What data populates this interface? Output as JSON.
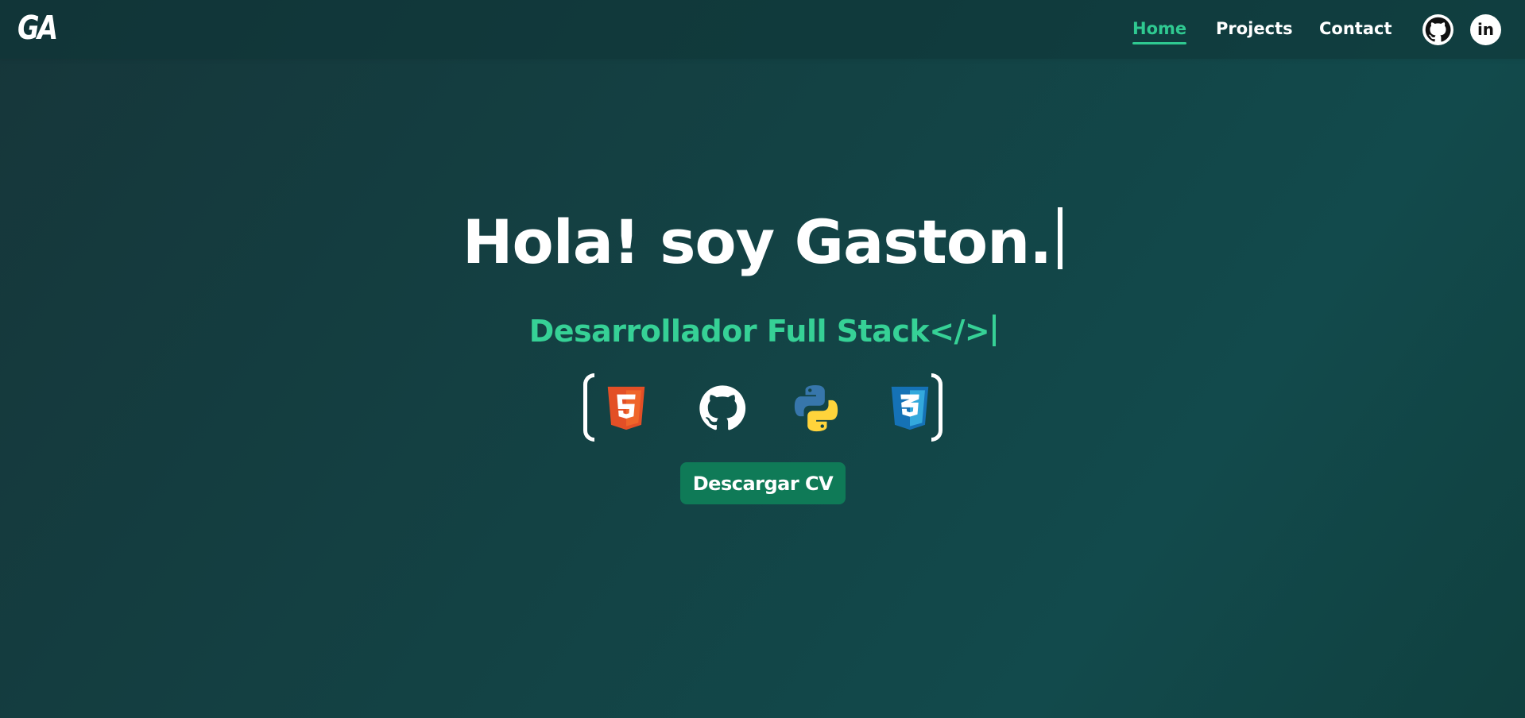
{
  "brand": {
    "logo_text": "GA"
  },
  "nav": {
    "items": [
      {
        "label": "Home",
        "active": true
      },
      {
        "label": "Projects",
        "active": false
      },
      {
        "label": "Contact",
        "active": false
      }
    ],
    "social": [
      {
        "icon": "github-icon"
      },
      {
        "icon": "linkedin-icon",
        "text": "in"
      }
    ]
  },
  "hero": {
    "title": "Hola! soy Gaston.",
    "subtitle": "Desarrollador Full Stack</>"
  },
  "skills": [
    {
      "icon": "html5-icon",
      "text": "5"
    },
    {
      "icon": "github-icon"
    },
    {
      "icon": "python-icon"
    },
    {
      "icon": "css3-icon",
      "text": "3"
    }
  ],
  "cta": {
    "label": "Descargar CV"
  },
  "colors": {
    "accent": "#2fc991",
    "background": "#134244",
    "button": "#0f7a57",
    "html5": "#e34f26",
    "css3": "#1572b6",
    "python_blue": "#3776ab",
    "python_yellow": "#ffd43b"
  }
}
